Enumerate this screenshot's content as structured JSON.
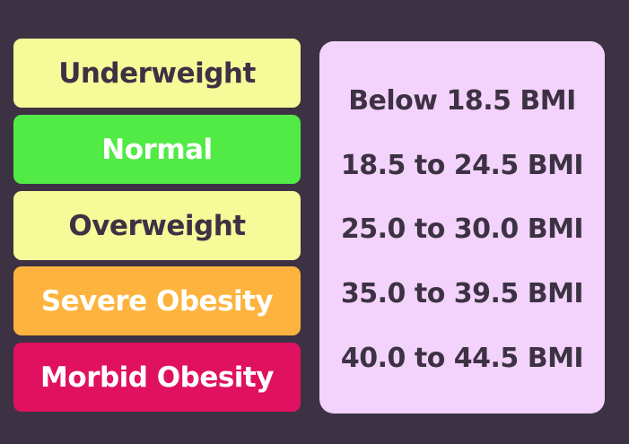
{
  "categories": [
    {
      "label": "Underweight",
      "bg": "#f6fa98",
      "color": "#3d3244"
    },
    {
      "label": "Normal",
      "bg": "#52ea45",
      "color": "#ffffff"
    },
    {
      "label": "Overweight",
      "bg": "#f6fa98",
      "color": "#3d3244"
    },
    {
      "label": "Severe Obesity",
      "bg": "#fdb33d",
      "color": "#ffffff"
    },
    {
      "label": "Morbid Obesity",
      "bg": "#e0115f",
      "color": "#ffffff"
    }
  ],
  "ranges": [
    "Below 18.5 BMI",
    "18.5 to 24.5 BMI",
    "25.0 to 30.0 BMI",
    "35.0 to 39.5 BMI",
    "40.0 to 44.5 BMI"
  ],
  "colors": {
    "background": "#3d3244",
    "panel": "#f3d3fb"
  }
}
